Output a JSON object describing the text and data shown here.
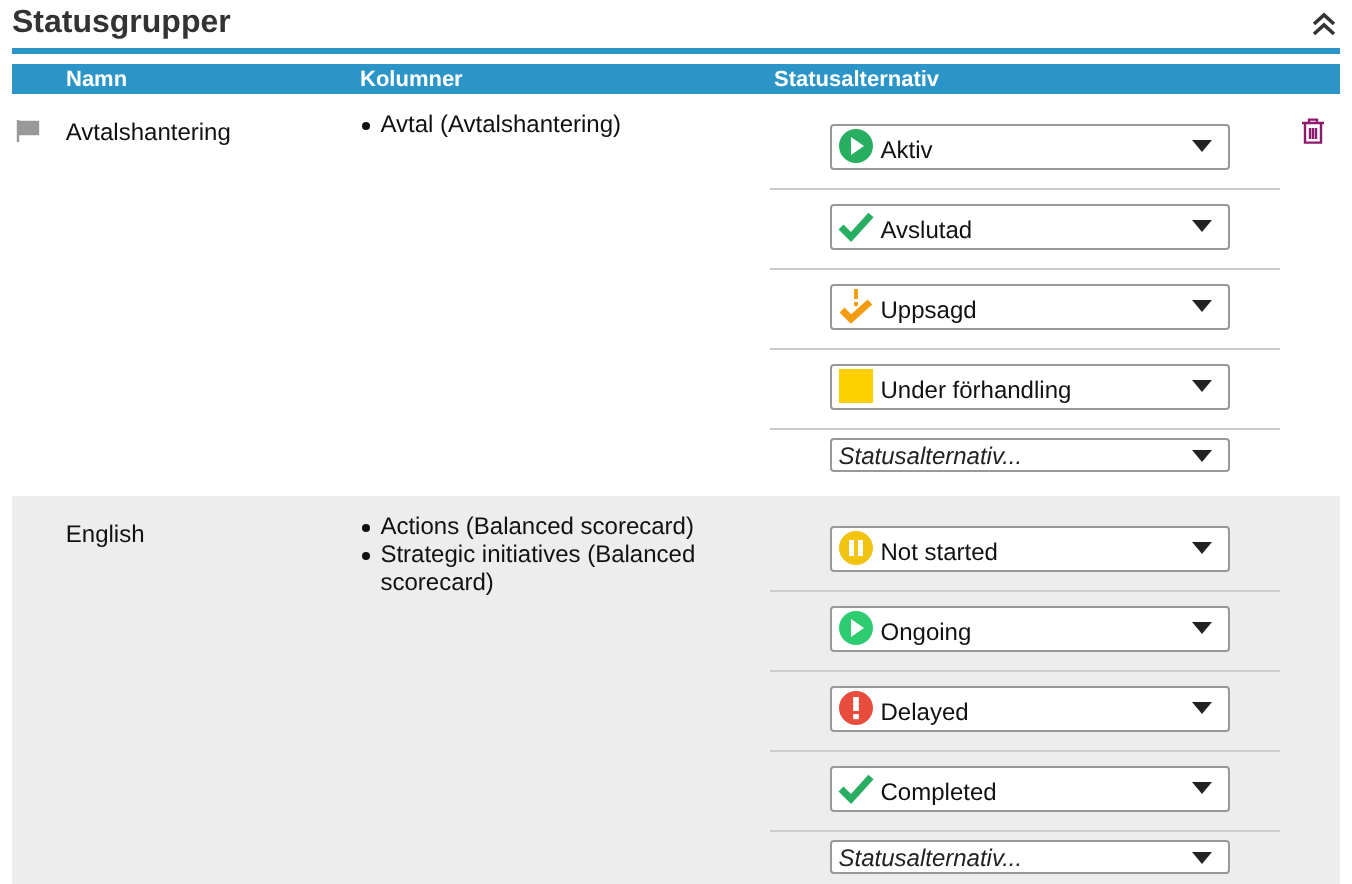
{
  "title": "Statusgrupper",
  "columns": [
    "Namn",
    "Kolumner",
    "Statusalternativ"
  ],
  "groups": [
    {
      "name": "Avtalshantering",
      "flag": true,
      "deletable": true,
      "shaded": false,
      "columns": [
        "Avtal (Avtalshantering)"
      ],
      "statuses": [
        {
          "kind": "play",
          "color": "#27ae60",
          "label": "Aktiv"
        },
        {
          "kind": "check",
          "color": "#27ae60",
          "label": "Avslutad"
        },
        {
          "kind": "warncheck",
          "color": "#f39c12",
          "label": "Uppsagd"
        },
        {
          "kind": "square",
          "color": "#ffd000",
          "label": "Under förhandling"
        }
      ],
      "placeholder": "Statusalternativ..."
    },
    {
      "name": "English",
      "flag": false,
      "deletable": false,
      "shaded": true,
      "columns": [
        "Actions (Balanced scorecard)",
        "Strategic initiatives (Balanced scorecard)"
      ],
      "statuses": [
        {
          "kind": "pause",
          "color": "#f1c40f",
          "label": "Not started"
        },
        {
          "kind": "play",
          "color": "#2ecc71",
          "label": "Ongoing"
        },
        {
          "kind": "alert",
          "color": "#e74c3c",
          "label": "Delayed"
        },
        {
          "kind": "check",
          "color": "#27ae60",
          "label": "Completed"
        }
      ],
      "placeholder": "Statusalternativ..."
    }
  ]
}
